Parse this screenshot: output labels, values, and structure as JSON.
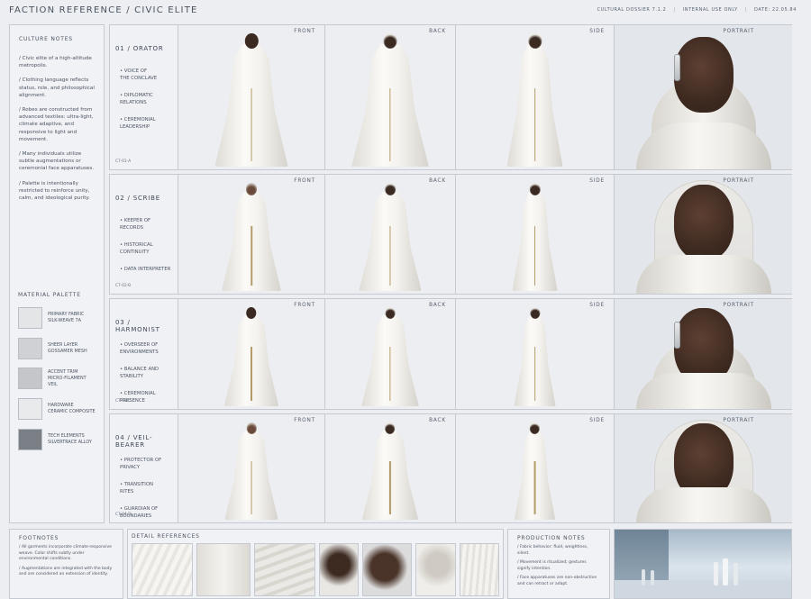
{
  "header": {
    "title": "FACTION REFERENCE / CIVIC ELITE",
    "dossier": "CULTURAL DOSSIER 7.1.2",
    "usage": "INTERNAL USE ONLY",
    "date": "DATE: 22.05.84"
  },
  "culture_notes": {
    "title": "CULTURE NOTES",
    "notes": [
      "/ Civic elite of a high-altitude metropolis.",
      "/ Clothing language reflects status, role, and philosophical alignment.",
      "/ Robes are constructed from advanced textiles: ultra-light, climate adaptive, and responsive to light and movement.",
      "/ Many individuals utilize subtle augmentations or ceremonial face apparatuses.",
      "/ Palette is intentionally restricted to reinforce unity, calm, and ideological purity."
    ]
  },
  "material_palette": {
    "title": "MATERIAL PALETTE",
    "items": [
      {
        "label": "PRIMARY FABRIC\nSILK-WEAVE 7A",
        "color": "#e4e5e7"
      },
      {
        "label": "SHEER LAYER\nGOSSAMER MESH",
        "color": "#cfd1d4"
      },
      {
        "label": "ACCENT TRIM\nMICRO-FILAMENT\nVEIL",
        "color": "#c4c6c9"
      },
      {
        "label": "HARDWARE\nCERAMIC COMPOSITE",
        "color": "#e9eaec"
      },
      {
        "label": "TECH ELEMENTS\nSILVERTRACE ALLOY",
        "color": "#7b7f86"
      }
    ]
  },
  "views": [
    "FRONT",
    "BACK",
    "SIDE",
    "PORTRAIT"
  ],
  "roles": [
    {
      "title": "01 / ORATOR",
      "responsibilities": [
        "VOICE OF\nTHE CONCLAVE",
        "DIPLOMATIC\nRELATIONS",
        "CEREMONIAL\nLEADERSHIP"
      ],
      "code": "C7-01-A"
    },
    {
      "title": "02 / SCRIBE",
      "responsibilities": [
        "KEEPER OF\nRECORDS",
        "HISTORICAL\nCONTINUITY",
        "DATA INTERPRETER"
      ],
      "code": "C7-02-B"
    },
    {
      "title": "03 / HARMONIST",
      "responsibilities": [
        "OVERSEER OF\nENVIRONMENTS",
        "BALANCE AND\nSTABILITY",
        "CEREMONIAL\nPRESENCE"
      ],
      "code": "C7-03-C"
    },
    {
      "title": "04 / VEIL-BEARER",
      "responsibilities": [
        "PROTECTOR OF\nPRIVACY",
        "TRANSITION\nRITES",
        "GUARDIAN OF\nBOUNDARIES"
      ],
      "code": "C7-04-D"
    }
  ],
  "footnotes": {
    "title": "FOOTNOTES",
    "items": [
      "/ All garments incorporate climate-responsive weave. Color shifts subtly under environmental conditions.",
      "/ Augmentations are integrated with the body and are considered an extension of identity."
    ]
  },
  "detail_references": {
    "title": "DETAIL REFERENCES"
  },
  "production_notes": {
    "title": "PRODUCTION NOTES",
    "items": [
      "/ Fabric behavior: fluid, weightless, silent.",
      "/ Movement is ritualized; gestures signify intention.",
      "/ Face apparatuses are non-obstructive and can retract or adapt."
    ]
  }
}
